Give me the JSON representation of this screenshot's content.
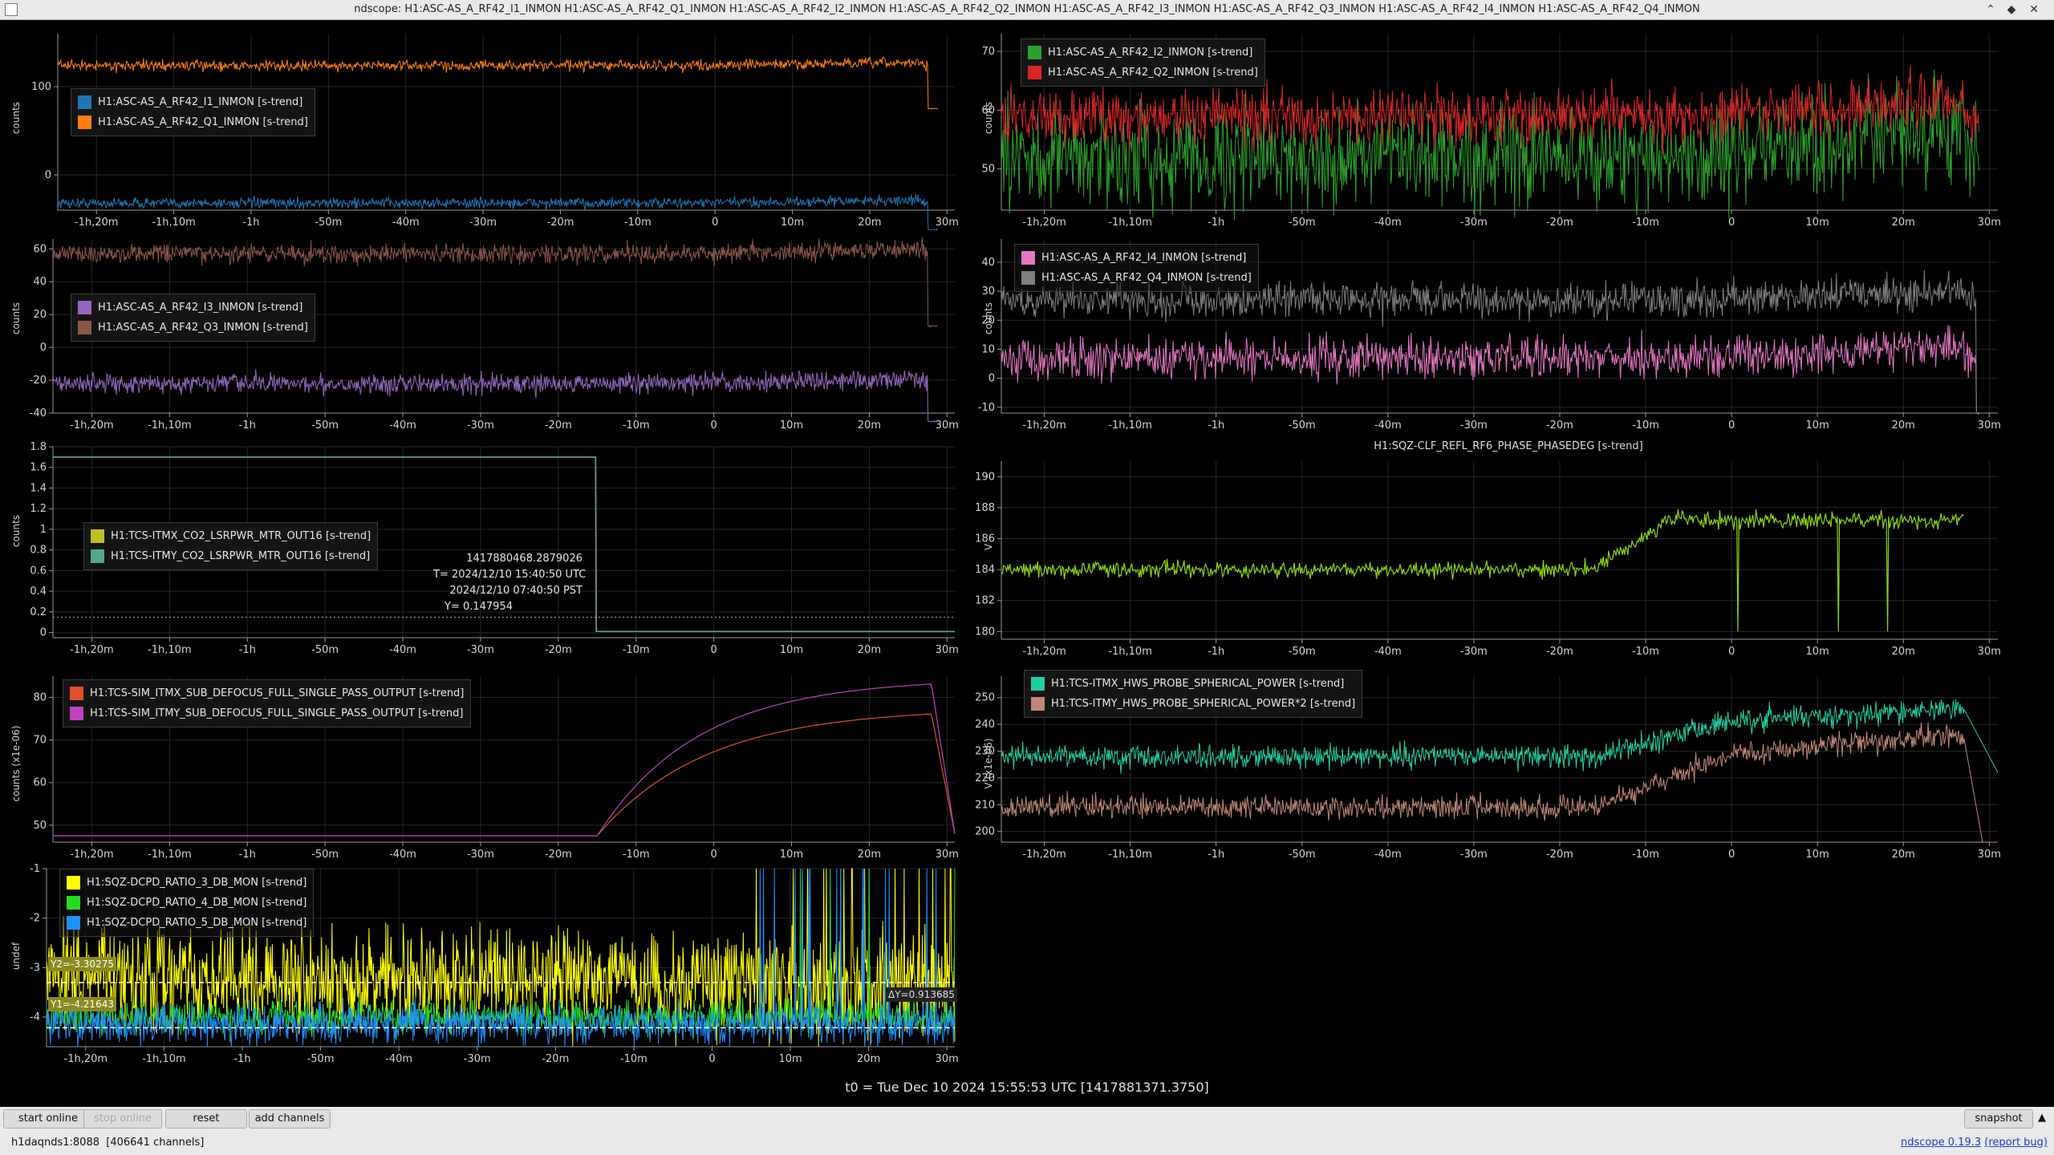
{
  "window": {
    "title": "ndscope: H1:ASC-AS_A_RF42_I1_INMON H1:ASC-AS_A_RF42_Q1_INMON H1:ASC-AS_A_RF42_I2_INMON H1:ASC-AS_A_RF42_Q2_INMON H1:ASC-AS_A_RF42_I3_INMON H1:ASC-AS_A_RF42_Q3_INMON H1:ASC-AS_A_RF42_I4_INMON H1:ASC-AS_A_RF42_Q4_INMON"
  },
  "time_axis": {
    "labels": [
      "-1h,20m",
      "-1h,10m",
      "-1h",
      "-50m",
      "-40m",
      "-30m",
      "-20m",
      "-10m",
      "0",
      "10m",
      "20m",
      "30m"
    ],
    "minutes": [
      -80,
      -70,
      -60,
      -50,
      -40,
      -30,
      -20,
      -10,
      0,
      10,
      20,
      30
    ]
  },
  "t0_label": "t0 = Tue Dec 10 2024 15:55:53 UTC [1417881371.3750]",
  "buttons": {
    "start_online": "start online",
    "stop_online": "stop online",
    "reset": "reset",
    "add_channels": "add channels",
    "snapshot": "snapshot"
  },
  "status": {
    "server": "h1daqnds1:8088",
    "channels": "[406641 channels]",
    "version_link": "ndscope 0.19.3",
    "report_bug": "(report bug)"
  },
  "chart_data": [
    {
      "id": "p1",
      "type": "line",
      "ylabel": "counts",
      "yticks": [
        0,
        100
      ],
      "ylim": [
        -40,
        160
      ],
      "series": [
        {
          "name": "H1:ASC-AS_A_RF42_I1_INMON [s-trend]",
          "color": "#1f77b4",
          "level": -32,
          "noise": 5,
          "drop_at": 27.5,
          "drop_to": -62
        },
        {
          "name": "H1:ASC-AS_A_RF42_Q1_INMON [s-trend]",
          "color": "#ff7f0e",
          "level": 124,
          "noise": 5,
          "drop_at": 27.5,
          "drop_to": 75
        }
      ]
    },
    {
      "id": "p2",
      "type": "line",
      "ylabel": "counts",
      "yticks": [
        50,
        60,
        70
      ],
      "ylim": [
        43,
        73
      ],
      "series": [
        {
          "name": "H1:ASC-AS_A_RF42_I2_INMON [s-trend]",
          "color": "#2ca02c",
          "level": 52,
          "noise": 7
        },
        {
          "name": "H1:ASC-AS_A_RF42_Q2_INMON [s-trend]",
          "color": "#d62728",
          "level": 59,
          "noise": 4
        }
      ]
    },
    {
      "id": "p3",
      "type": "line",
      "ylabel": "counts",
      "yticks": [
        -40,
        -20,
        0,
        20,
        40,
        60
      ],
      "ylim": [
        -40,
        66
      ],
      "series": [
        {
          "name": "H1:ASC-AS_A_RF42_I3_INMON [s-trend]",
          "color": "#9467bd",
          "level": -22,
          "noise": 5,
          "drop_at": 27.5,
          "drop_to": -45
        },
        {
          "name": "H1:ASC-AS_A_RF42_Q3_INMON [s-trend]",
          "color": "#8c564b",
          "level": 57,
          "noise": 5,
          "drop_at": 27.5,
          "drop_to": 13
        }
      ]
    },
    {
      "id": "p4",
      "type": "line",
      "ylabel": "counts",
      "yticks": [
        -10,
        0,
        10,
        20,
        30,
        40
      ],
      "ylim": [
        -12,
        48
      ],
      "series": [
        {
          "name": "H1:ASC-AS_A_RF42_I4_INMON [s-trend]",
          "color": "#e377c2",
          "level": 7,
          "noise": 6,
          "drop_at": 28.5,
          "drop_to": -12
        },
        {
          "name": "H1:ASC-AS_A_RF42_Q4_INMON [s-trend]",
          "color": "#7f7f7f",
          "level": 27,
          "noise": 5,
          "drop_at": 28.5,
          "drop_to": -12
        }
      ]
    },
    {
      "id": "p5",
      "type": "line",
      "ylabel": "counts",
      "yticks": [
        0,
        0.2,
        0.4,
        0.6,
        0.8,
        1,
        1.2,
        1.4,
        1.6,
        1.8
      ],
      "ylim": [
        -0.05,
        1.8
      ],
      "series": [
        {
          "name": "H1:TCS-ITMX_CO2_LSRPWR_MTR_OUT16 [s-trend]",
          "color": "#bcbd22",
          "level": 1.7,
          "noise": 0,
          "drop_at": -15.2,
          "drop_to": 0.01
        },
        {
          "name": "H1:TCS-ITMY_CO2_LSRPWR_MTR_OUT16 [s-trend]",
          "color": "#55aa88",
          "level": 1.7,
          "noise": 0,
          "drop_at": -15.2,
          "drop_to": 0.01
        }
      ],
      "cursor": {
        "gps": "1417880468.2879026",
        "utc": "T= 2024/12/10 15:40:50 UTC",
        "pst": "2024/12/10 07:40:50 PST",
        "y": "Y= 0.147954",
        "y_value": 0.147954
      }
    },
    {
      "id": "p6",
      "type": "line",
      "title": "H1:SQZ-CLF_REFL_RF6_PHASE_PHASEDEG [s-trend]",
      "ylabel": "V",
      "yticks": [
        180,
        182,
        184,
        186,
        188,
        190
      ],
      "ylim": [
        179.5,
        191
      ],
      "series": [
        {
          "name": "H1:SQZ-CLF_REFL_RF6_PHASE_PHASEDEG [s-trend]",
          "color": "#8cd610"
        }
      ]
    },
    {
      "id": "p7",
      "type": "line",
      "ylabel": "counts (x1e-06)",
      "yticks": [
        50,
        60,
        70,
        80
      ],
      "ylim": [
        46,
        85
      ],
      "series": [
        {
          "name": "H1:TCS-SIM_ITMX_SUB_DEFOCUS_FULL_SINGLE_PASS_OUTPUT [s-trend]",
          "color": "#e0502a"
        },
        {
          "name": "H1:TCS-SIM_ITMY_SUB_DEFOCUS_FULL_SINGLE_PASS_OUTPUT [s-trend]",
          "color": "#c040c0"
        }
      ]
    },
    {
      "id": "p8",
      "type": "line",
      "ylabel": "V (x1e-06)",
      "yticks": [
        200,
        210,
        220,
        230,
        240,
        250
      ],
      "ylim": [
        196,
        258
      ],
      "series": [
        {
          "name": "H1:TCS-ITMX_HWS_PROBE_SPHERICAL_POWER [s-trend]",
          "color": "#20d0a0"
        },
        {
          "name": "H1:TCS-ITMY_HWS_PROBE_SPHERICAL_POWER*2 [s-trend]",
          "color": "#c08878"
        }
      ]
    },
    {
      "id": "p9",
      "type": "line",
      "ylabel": "undef",
      "yticks": [
        -1,
        -2,
        -3,
        -4
      ],
      "ylim": [
        -4.6,
        -1
      ],
      "series": [
        {
          "name": "H1:SQZ-DCPD_RATIO_3_DB_MON [s-trend]",
          "color": "#ffff00"
        },
        {
          "name": "H1:SQZ-DCPD_RATIO_4_DB_MON [s-trend]",
          "color": "#22dd22"
        },
        {
          "name": "H1:SQZ-DCPD_RATIO_5_DB_MON [s-trend]",
          "color": "#1e90ff"
        }
      ],
      "cursor": {
        "y1": "Y1=-4.21643",
        "y2": "Y2=-3.30275",
        "dy": "ΔY=0.913685",
        "y1_value": -4.21643,
        "y2_value": -3.30275
      }
    }
  ]
}
